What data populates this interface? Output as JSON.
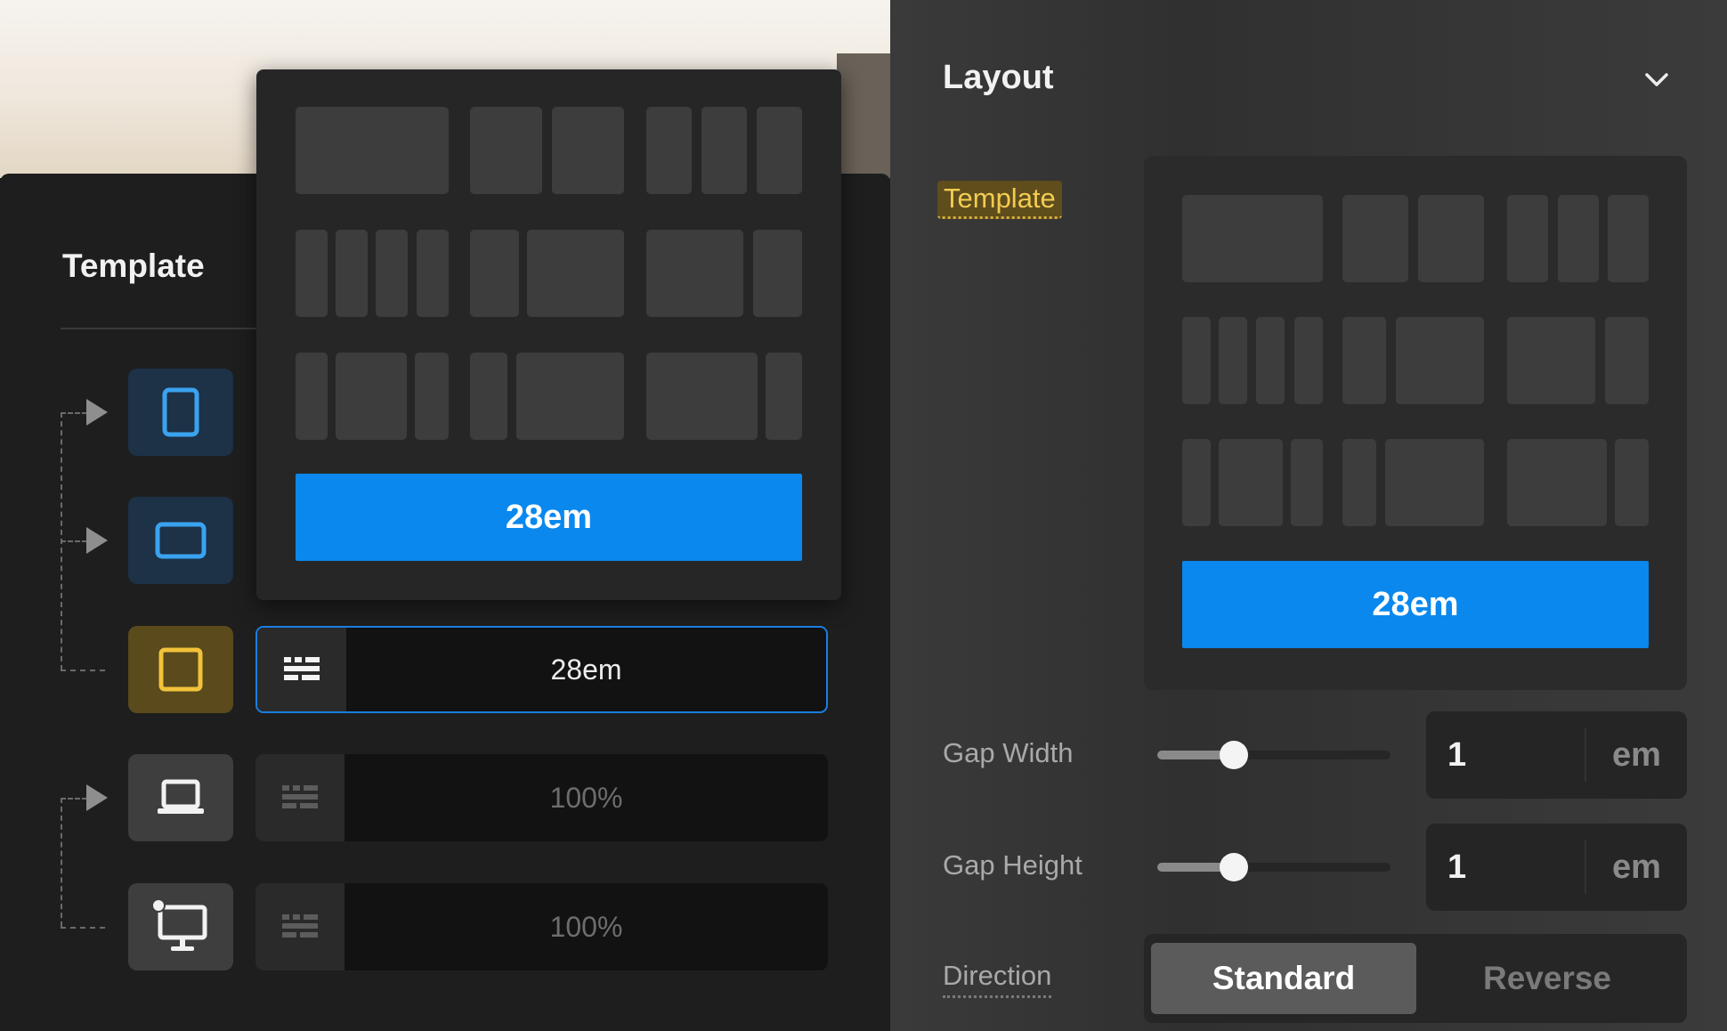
{
  "left_panel": {
    "title": "Template",
    "rows": [
      {
        "device": "tablet-portrait",
        "value": ""
      },
      {
        "device": "tablet-landscape",
        "value": ""
      },
      {
        "device": "square",
        "value": "28em",
        "active": true
      },
      {
        "device": "laptop",
        "value": "100%"
      },
      {
        "device": "desktop",
        "value": "100%"
      }
    ]
  },
  "popup": {
    "selected_value": "28em"
  },
  "layout_panel": {
    "title": "Layout",
    "template_label": "Template",
    "selected_value": "28em",
    "gap_width": {
      "label": "Gap Width",
      "value": "1",
      "unit": "em",
      "slider_fraction": 0.33
    },
    "gap_height": {
      "label": "Gap Height",
      "value": "1",
      "unit": "em",
      "slider_fraction": 0.33
    },
    "direction": {
      "label": "Direction",
      "options": [
        "Standard",
        "Reverse"
      ],
      "selected": "Standard"
    }
  },
  "colors": {
    "accent_blue": "#0a88ee",
    "highlight_gold": "#f2cb52"
  }
}
